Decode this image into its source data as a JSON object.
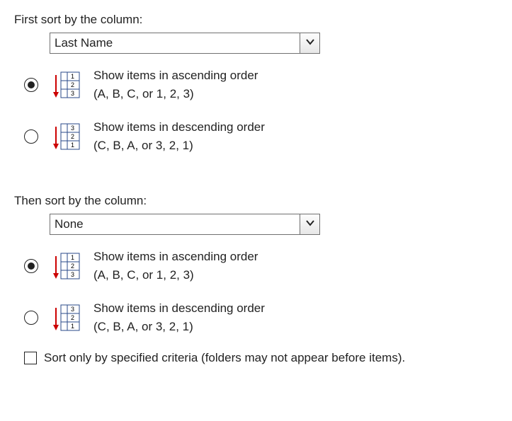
{
  "first": {
    "label": "First sort by the column:",
    "selected": "Last Name",
    "asc": {
      "line1": "Show items in ascending order",
      "line2": "(A, B, C, or 1, 2, 3)",
      "checked": true
    },
    "desc": {
      "line1": "Show items in descending order",
      "line2": "(C, B, A, or 3, 2, 1)",
      "checked": false
    }
  },
  "then": {
    "label": "Then sort by the column:",
    "selected": "None",
    "asc": {
      "line1": "Show items in ascending order",
      "line2": "(A, B, C, or 1, 2, 3)",
      "checked": true
    },
    "desc": {
      "line1": "Show items in descending order",
      "line2": "(C, B, A, or 3, 2, 1)",
      "checked": false
    }
  },
  "sort_only": {
    "label": "Sort only by specified criteria (folders may not appear before items).",
    "checked": false
  }
}
